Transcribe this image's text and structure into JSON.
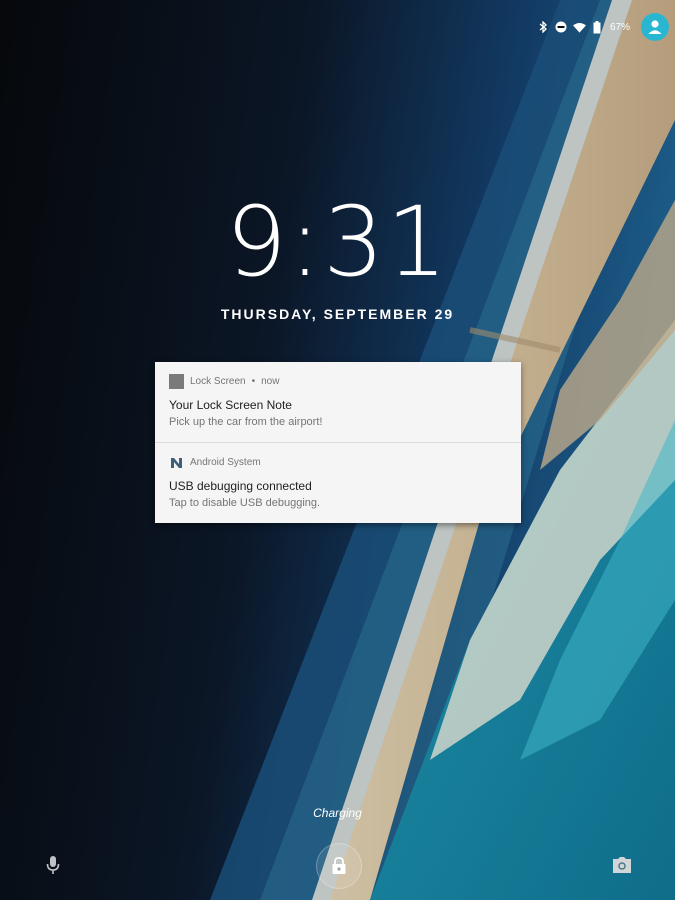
{
  "status_bar": {
    "battery_percent": "67%",
    "icons": [
      "bluetooth-icon",
      "do-not-disturb-icon",
      "wifi-icon",
      "battery-icon",
      "user-avatar-icon"
    ]
  },
  "lockscreen": {
    "time": "9:31",
    "date": "THURSDAY, SEPTEMBER 29",
    "charging": "Charging"
  },
  "notifications": [
    {
      "app": "Lock Screen",
      "when": "now",
      "title": "Your Lock Screen Note",
      "text": "Pick up the car from the airport!"
    },
    {
      "app": "Android System",
      "title": "USB debugging connected",
      "text": "Tap to disable USB debugging."
    }
  ],
  "colors": {
    "accent": "#29b6d1",
    "notification_bg": "#f5f5f5"
  }
}
